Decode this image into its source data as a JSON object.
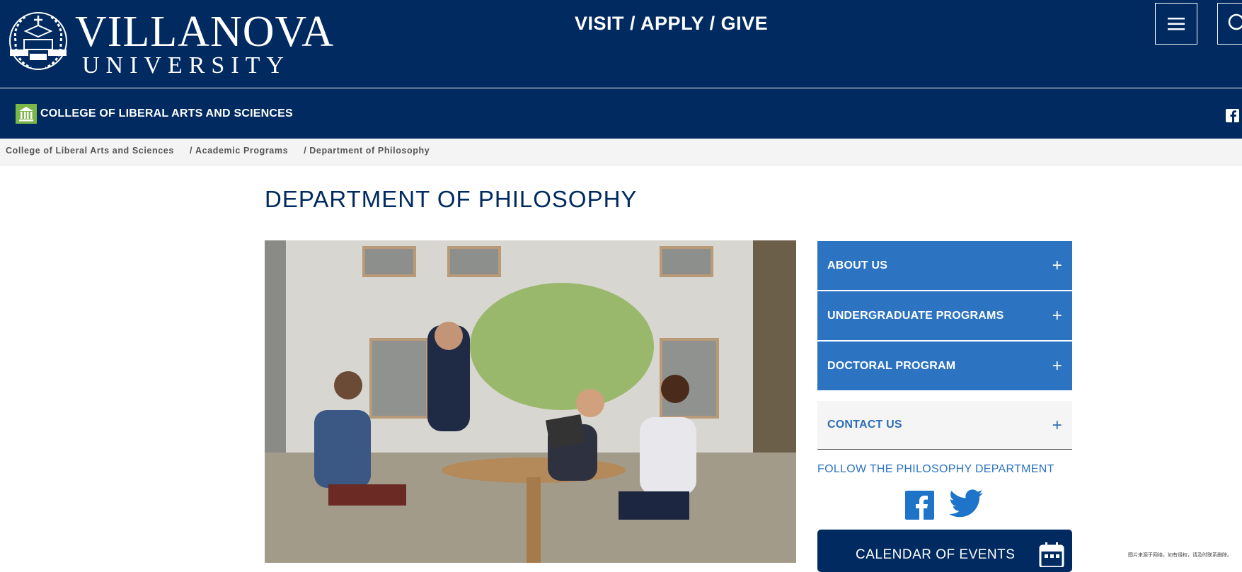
{
  "header": {
    "logo_line1": "VILLANOVA",
    "logo_line2": "UNIVERSITY",
    "seal_text": [
      "VERITAS",
      "UNITAS",
      "CARITAS",
      "1842"
    ],
    "links": [
      "VISIT",
      "APPLY",
      "GIVE"
    ],
    "link_separator": "/",
    "menu_icon": "hamburger-icon",
    "search_icon": "search-icon"
  },
  "college_bar": {
    "label": "COLLEGE OF LIBERAL ARTS AND SCIENCES",
    "icon": "building-icon",
    "social_icon": "facebook-icon"
  },
  "breadcrumb": {
    "items": [
      "College of Liberal Arts and Sciences",
      "Academic Programs",
      "Department of Philosophy"
    ]
  },
  "page": {
    "title": "DEPARTMENT OF PHILOSOPHY"
  },
  "sidebar": {
    "accordion": [
      {
        "label": "ABOUT US",
        "style": "blue"
      },
      {
        "label": "UNDERGRADUATE PROGRAMS",
        "style": "blue"
      },
      {
        "label": "DOCTORAL PROGRAM",
        "style": "blue"
      },
      {
        "label": "CONTACT US",
        "style": "light"
      }
    ],
    "expand_symbol": "+",
    "follow_label": "FOLLOW THE PHILOSOPHY DEPARTMENT",
    "social": [
      "facebook-icon",
      "twitter-icon"
    ],
    "calendar_label": "CALENDAR OF EVENTS",
    "calendar_icon": "calendar-icon"
  },
  "watermark": "图片来源于网络，如有侵权，请及时联系删除。",
  "colors": {
    "navy": "#002a60",
    "accent_blue": "#2c73c2",
    "green": "#7ab648"
  }
}
